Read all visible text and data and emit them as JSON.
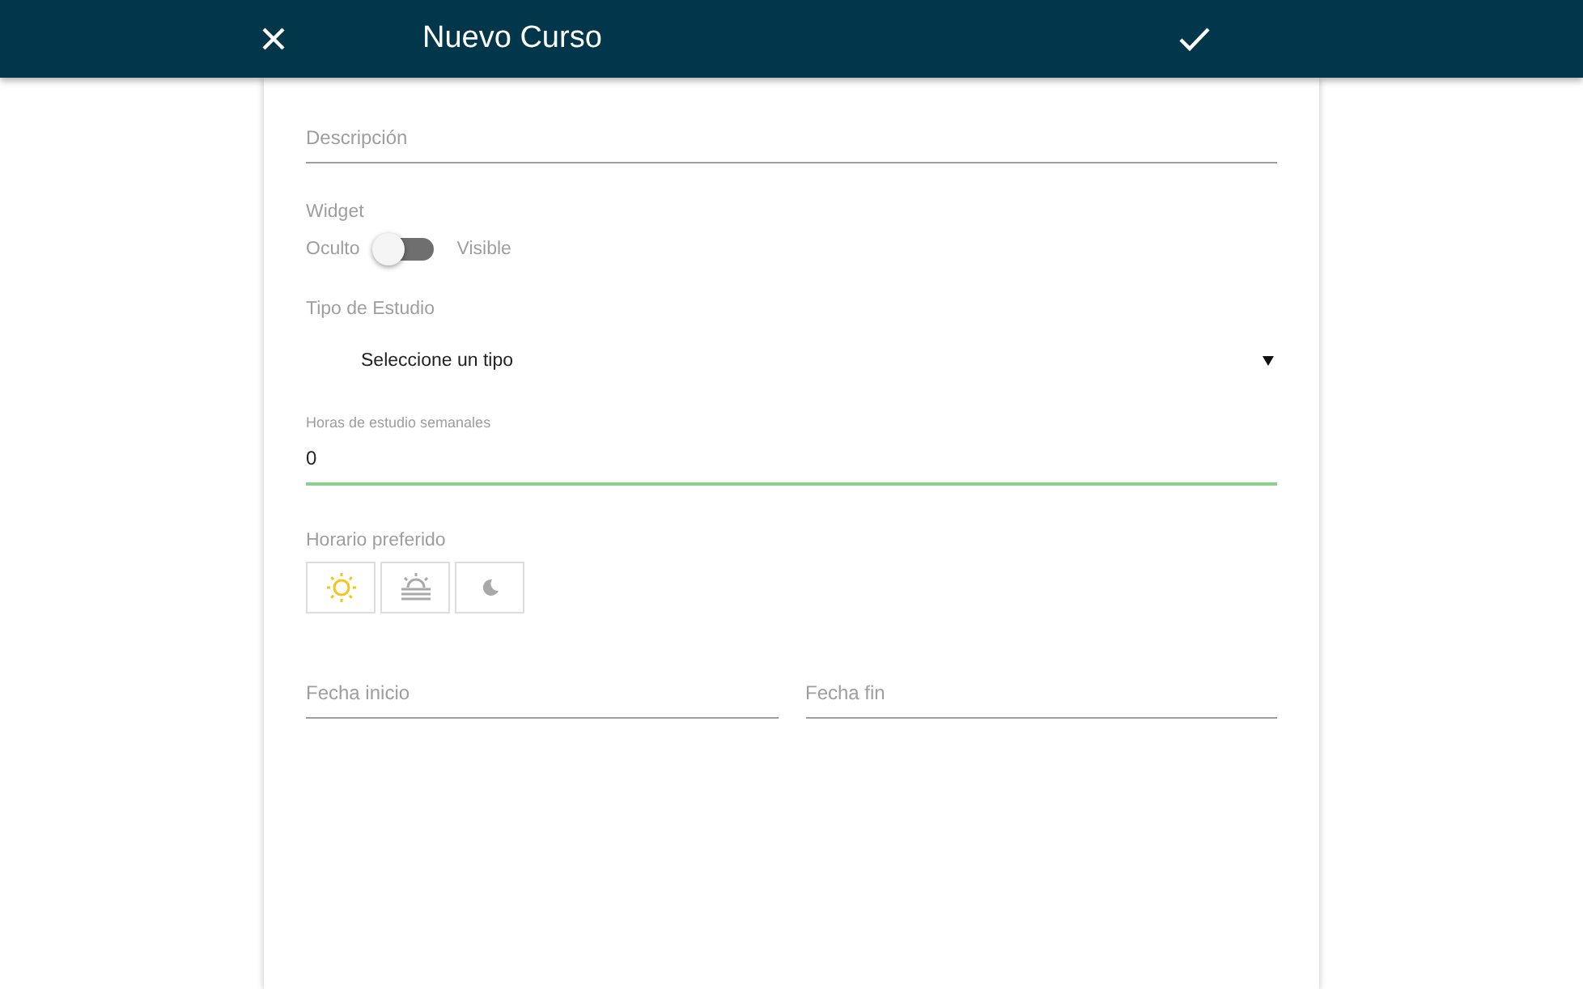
{
  "header": {
    "title": "Nuevo Curso"
  },
  "description": {
    "placeholder": "Descripción"
  },
  "widget": {
    "label": "Widget",
    "off_label": "Oculto",
    "on_label": "Visible",
    "on": false
  },
  "study_type": {
    "label": "Tipo de Estudio",
    "value": "Seleccione un tipo"
  },
  "weekly_hours": {
    "label": "Horas de estudio semanales",
    "value": "0",
    "focused": true
  },
  "schedule": {
    "label": "Horario preferido",
    "options": [
      {
        "kind": "day",
        "selected": true
      },
      {
        "kind": "evening",
        "selected": false
      },
      {
        "kind": "night",
        "selected": false
      }
    ]
  },
  "dates": [
    {
      "placeholder": "Fecha inicio"
    },
    {
      "placeholder": "Fecha fin"
    }
  ]
}
